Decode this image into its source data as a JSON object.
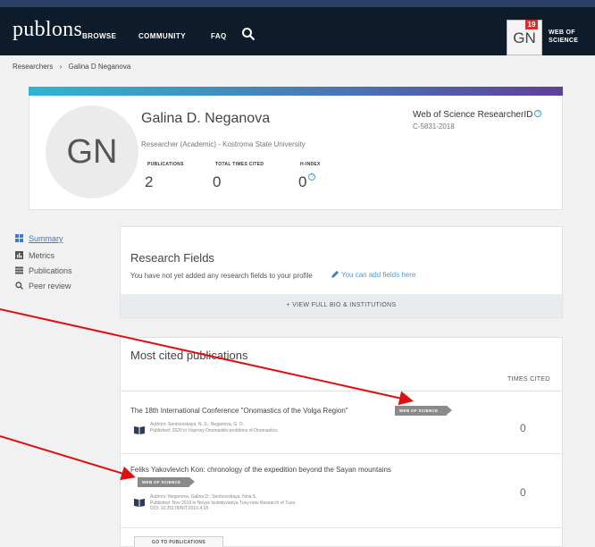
{
  "header": {
    "logo": "publons",
    "nav": [
      "BROWSE",
      "COMMUNITY",
      "FAQ"
    ],
    "avatar_initials": "GN",
    "notification_count": "19",
    "wos_line1": "WEB OF",
    "wos_line2": "SCIENCE"
  },
  "breadcrumb": {
    "root": "Researchers",
    "separator": "›",
    "current": "Galina D Neganova"
  },
  "profile": {
    "initials": "GN",
    "name": "Galina D. Neganova",
    "affiliation": "Researcher (Academic) - Kostroma State University",
    "stats": [
      {
        "label": "PUBLICATIONS",
        "value": "2"
      },
      {
        "label": "TOTAL TIMES CITED",
        "value": "0"
      },
      {
        "label": "H-INDEX",
        "value": "0"
      }
    ],
    "researcher_id_title": "Web of Science ResearcherID",
    "researcher_id": "C-5831-2018"
  },
  "sidebar": {
    "items": [
      {
        "label": "Summary",
        "icon": "summary-icon"
      },
      {
        "label": "Metrics",
        "icon": "metrics-icon"
      },
      {
        "label": "Publications",
        "icon": "list-icon"
      },
      {
        "label": "Peer review",
        "icon": "search-icon"
      }
    ]
  },
  "fields": {
    "title": "Research Fields",
    "empty_text": "You have not yet added any research fields to your profile",
    "add_link": "You can add fields here",
    "bio_button": "+ VIEW FULL BIO & INSTITUTIONS"
  },
  "publications": {
    "title": "Most cited publications",
    "times_cited_header": "TIMES CITED",
    "badge": "WEB OF SCIENCE",
    "items": [
      {
        "title": "The 18th International Conference \"Onomastics of the Volga Region\"",
        "authors": "Authors: Sentsovskaya, N. S.; Neganova, G. D.",
        "published": "Published: 2020 in Voprosy Onomastiki-problems of Onomastics",
        "doi": "",
        "cited": "0"
      },
      {
        "title": "Feliks Yakovlevich Kon: chronology of the expedition beyond the Sayan mountains",
        "authors": "Authors: Neganova, Galina D.; Sentsovskaya, Nina S.",
        "published": "Published: Nov 2019 in Novye Issledovaniya Tuvy-new Research of Tuva",
        "doi": "DOI: 10.25178/NIT.2019.4.18",
        "cited": "0"
      }
    ],
    "goto_button": "GO TO PUBLICATIONS"
  },
  "colors": {
    "header_bg": "#0d1b2a",
    "accent": "#4a9fd5",
    "badge": "#8a8a8a",
    "annotation_arrow": "#e01010"
  }
}
